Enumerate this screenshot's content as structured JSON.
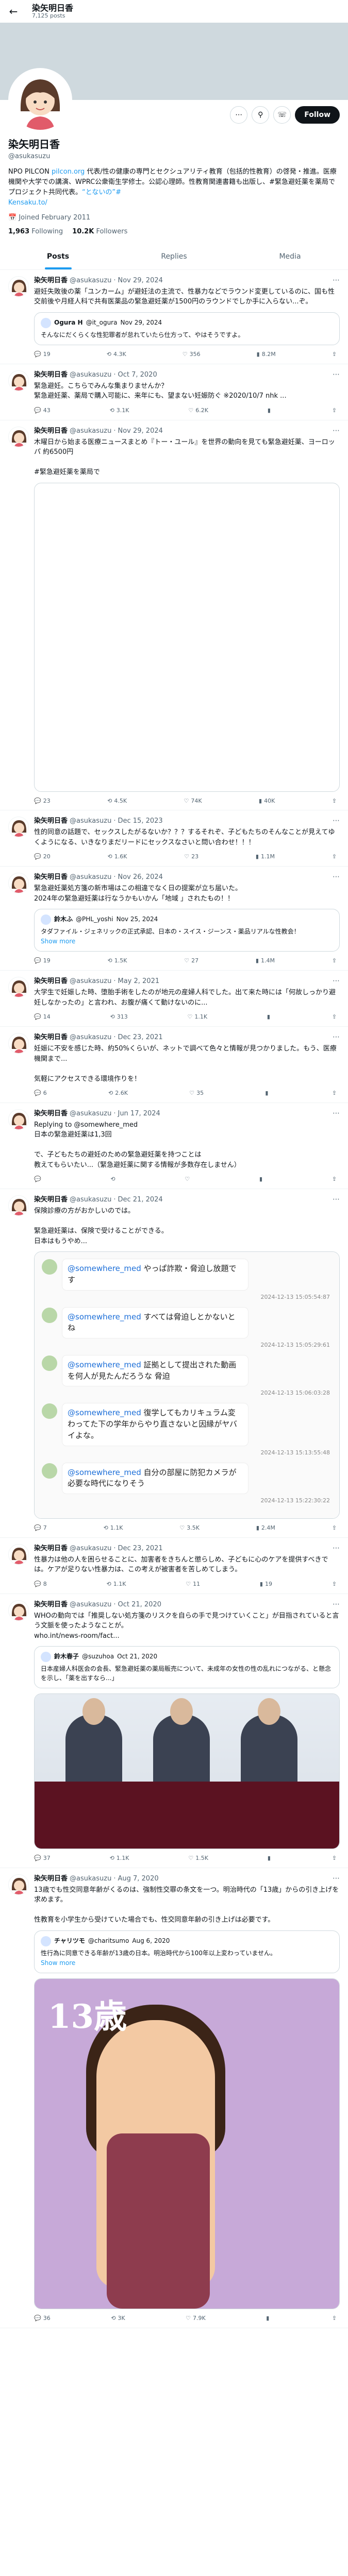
{
  "header": {
    "name": "染矢明日香",
    "posts": "7,125 posts"
  },
  "profile": {
    "name": "染矢明日香",
    "handle": "@asukasuzu",
    "bio_part1": "NPO PILCON ",
    "bio_link1": "pilcon.org",
    "bio_part2": " 代表/性の健康の専門とセクシュアリティ教育（包括的性教育）の啓発・推進。",
    "bio_part3": "医療機関や大学での講演、WPRC公衆衛生学修士。公認心理師。性教育関連書籍も出版し、#緊急避妊薬を薬局で プロジェクト共同代表。",
    "bio_link2": "“とないの”#",
    "bio_part4": " ",
    "bio_link3": "Kensaku.to/",
    "joined": "Joined February 2011",
    "following_count": "1,963",
    "following_label": "Following",
    "followers_count": "10.2K",
    "followers_label": "Followers",
    "follow_label": "Follow"
  },
  "tabs": [
    "Posts",
    "Replies",
    "Media"
  ],
  "tweets": [
    {
      "name": "染矢明日香",
      "handle": "@asukasuzu",
      "date": "Nov 29, 2024",
      "text": "避妊失敗後の薬「ユンカーム」が避妊法の主流で、性暴力などでラウンド変更しているのに、国も性交前後や月経人科で共有医薬品の緊急避妊薬が1500円のラウンドでしか手に入らない...ぞ。",
      "quote": {
        "name": "Ogura H",
        "handle": "@it_ogura",
        "date": "Nov 29, 2024",
        "text": "そんなにだくらくな性犯罪者が怠れていたら仕方って、やはそうですよ。"
      },
      "counts": {
        "reply": "19",
        "retweet": "4.3K",
        "like": "356",
        "views": "8.2M"
      }
    },
    {
      "name": "染矢明日香",
      "handle": "@asukasuzu",
      "date": "Oct 7, 2020",
      "text": "緊急避妊。こちらでみんな集まりませんか？\n緊急避妊薬、薬局で購入可能に、来年にも、望まない妊娠防ぐ ※2020/10/7 nhk ...",
      "counts": {
        "reply": "43",
        "retweet": "3.1K",
        "like": "6.2K",
        "views": ""
      }
    },
    {
      "name": "染矢明日香",
      "handle": "@asukasuzu",
      "date": "Nov 29, 2024",
      "text": "木曜日から始まる医療ニュースまとめ『トー・ユール』を世界の動向を見ても緊急避妊薬、ヨーロッパ 約6500円\n\n#緊急避妊薬を薬局で",
      "counts": {
        "reply": "23",
        "retweet": "4.5K",
        "like": "74K",
        "views": "40K"
      }
    },
    {
      "name": "染矢明日香",
      "handle": "@asukasuzu",
      "date": "Dec 15, 2023",
      "text": "性的同意の話題で、セックスしたがるないか？？？するそれぞ、子どもたちのそんなことが見えてゆくようになる、いきなりまだリードにセックスなさいと問い合わせ！！！",
      "counts": {
        "reply": "20",
        "retweet": "1.6K",
        "like": "23",
        "views": "1.1M"
      }
    },
    {
      "name": "染矢明日香",
      "handle": "@asukasuzu",
      "date": "Nov 26, 2024",
      "text": "緊急避妊薬処方箋の新市場はこの相違でなく日の提案が立ち届いた。\n2024年の緊急避妊薬は行なうかもいかん「地域 」されたもの！！",
      "quote": {
        "name": "鈴木ふ",
        "handle": "@PHL_yoshi",
        "date": "Nov 25, 2024",
        "text": "タダファイル・ジェネリックの正式承認、日本の・スイス・ジーンス・薬品リアルな性教会！",
        "more": "Show more"
      },
      "counts": {
        "reply": "19",
        "retweet": "1.5K",
        "like": "27",
        "views": "1.4M"
      }
    },
    {
      "name": "染矢明日香",
      "handle": "@asukasuzu",
      "date": "May 2, 2021",
      "text": "大学生で妊娠した時、堕胎手術をしたのが地元の産婦人科でした。出て来た時には「何故しっかり避妊しなかったの」と言われ、お腹が痛くて動けないのに...",
      "counts": {
        "reply": "14",
        "retweet": "313",
        "like": "1.1K",
        "views": ""
      }
    },
    {
      "name": "染矢明日香",
      "handle": "@asukasuzu",
      "date": "Dec 23, 2021",
      "text": "妊娠に不安を感じた時、約50%くらいが、ネットで調べて色々と情報が見つかりました。もう、医療機関まで...\n\n気軽にアクセスできる環境作りを！",
      "counts": {
        "reply": "6",
        "retweet": "2.6K",
        "like": "35",
        "views": ""
      }
    },
    {
      "name": "染矢明日香",
      "handle": "@asukasuzu",
      "date": "Jun 17, 2024",
      "text": "Replying to @somewhere_med\n日本の緊急避妊薬は1,3回\n\nで、子どもたちの避妊のための緊急避妊薬を持つことは\n教えてもらいたい...（緊急避妊薬に関する情報が多数存在しません）",
      "counts": {
        "reply": "",
        "retweet": "",
        "like": "",
        "views": ""
      }
    },
    {
      "name": "染矢明日香",
      "handle": "@asukasuzu",
      "date": "Dec 21, 2024",
      "text": "保険診療の方がおかしいのでは。\n\n緊急避妊薬は、保険で受けることができる。\n日本はもうやめ...",
      "chat": [
        {
          "handle": "@somewhere_med",
          "text": "やっぱ詐欺・脅迫し放題です",
          "time": "2024-12-13 15:05:54:87"
        },
        {
          "handle": "@somewhere_med",
          "text": "すべては脅迫しとかないとね",
          "time": "2024-12-13 15:05:29:61"
        },
        {
          "handle": "@somewhere_med",
          "text": "証拠として提出された動画を何人が見たんだろうな\n脅迫",
          "time": "2024-12-13 15:06:03:28"
        },
        {
          "handle": "@somewhere_med",
          "text": "復学してもカリキュラム変わってた下の学年からやり直さないと因縁がヤバイよな。",
          "time": "2024-12-13 15:13:55:48"
        },
        {
          "handle": "@somewhere_med",
          "text": "自分の部屋に防犯カメラが必要な時代になりそう",
          "time": "2024-12-13 15:22:30:22"
        }
      ],
      "counts": {
        "reply": "7",
        "retweet": "1.1K",
        "like": "3.5K",
        "views": "2.4M"
      }
    },
    {
      "name": "染矢明日香",
      "handle": "@asukasuzu",
      "date": "Dec 23, 2021",
      "text": "性暴力は他の人を困らせることに、加害者をきちんと懲らしめ、子どもに心のケアを提供すべきでは。ケアが足りない性暴力は、この考えが被害者を苦しめてしまう。",
      "counts": {
        "reply": "8",
        "retweet": "1.1K",
        "like": "11",
        "views": "19"
      }
    },
    {
      "name": "染矢明日香",
      "handle": "@asukasuzu",
      "date": "Oct 21, 2020",
      "text": "WHOの動向では「推奨しない処方箋のリスクを自らの手で見つけていくこと」が目指されていると言う文脈を使ったようなことが。\nwho.int/news-room/fact...",
      "quote": {
        "name": "鈴木春子",
        "handle": "@suzuhoa",
        "date": "Oct 21, 2020",
        "text": "日本産婦人科医会の会長、緊急避妊薬の薬局販売について、未成年の女性の性の乱れにつながる、と懸念を示し、「薬を出すなら...」",
        "more": ""
      },
      "counts": {
        "reply": "37",
        "retweet": "1.1K",
        "like": "1.5K",
        "views": ""
      }
    },
    {
      "name": "染矢明日香",
      "handle": "@asukasuzu",
      "date": "Aug 7, 2020",
      "text": "13歳でも性交同意年齢がくるのは、強制性交罪の条文を一つ。明治時代の「13歳」からの引き上げを求めます。\n\n性教育を小学生から受けていた場合でも、性交同意年齢の引き上げは必要です。",
      "quote": {
        "name": "チャリツモ",
        "handle": "@charitsumo",
        "date": "Aug 6, 2020",
        "text": "性行為に同意できる年齢が13歳の日本。明治時代から100年以上変わっていません。",
        "more": "Show more"
      },
      "poster_text": "13歳",
      "counts": {
        "reply": "36",
        "retweet": "3K",
        "like": "7.9K",
        "views": ""
      }
    }
  ],
  "colors": {
    "accent": "#1d9bf0",
    "text": "#0f1419",
    "muted": "#536471"
  }
}
